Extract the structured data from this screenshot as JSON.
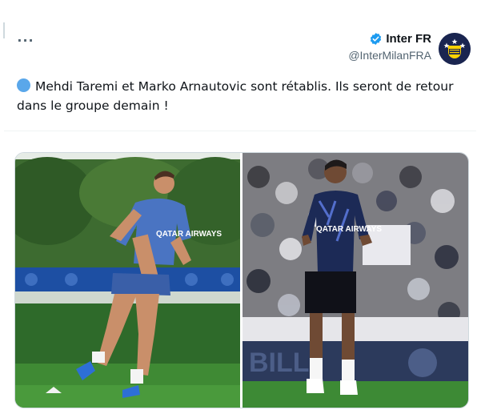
{
  "tweet": {
    "author_name": "Inter FR",
    "handle": "@InterMilanFRA",
    "more_label": "···",
    "text": "Mehdi Taremi et Marko Arnautovic sont rétablis. Ils seront de retour dans le groupe demain !",
    "icons": {
      "more": "more-dots-icon",
      "verified": "verified-badge-icon",
      "bullet": "blue-circle-emoji"
    },
    "colors": {
      "verified": "#1d9bf0",
      "text": "#0f1419",
      "secondary": "#536471",
      "bullet": "#5aa7ea"
    }
  },
  "media": {
    "photos": [
      {
        "sponsor_text": "QATAR AIRWAYS"
      },
      {
        "sponsor_text": "QATAR AIRWAYS"
      }
    ]
  }
}
